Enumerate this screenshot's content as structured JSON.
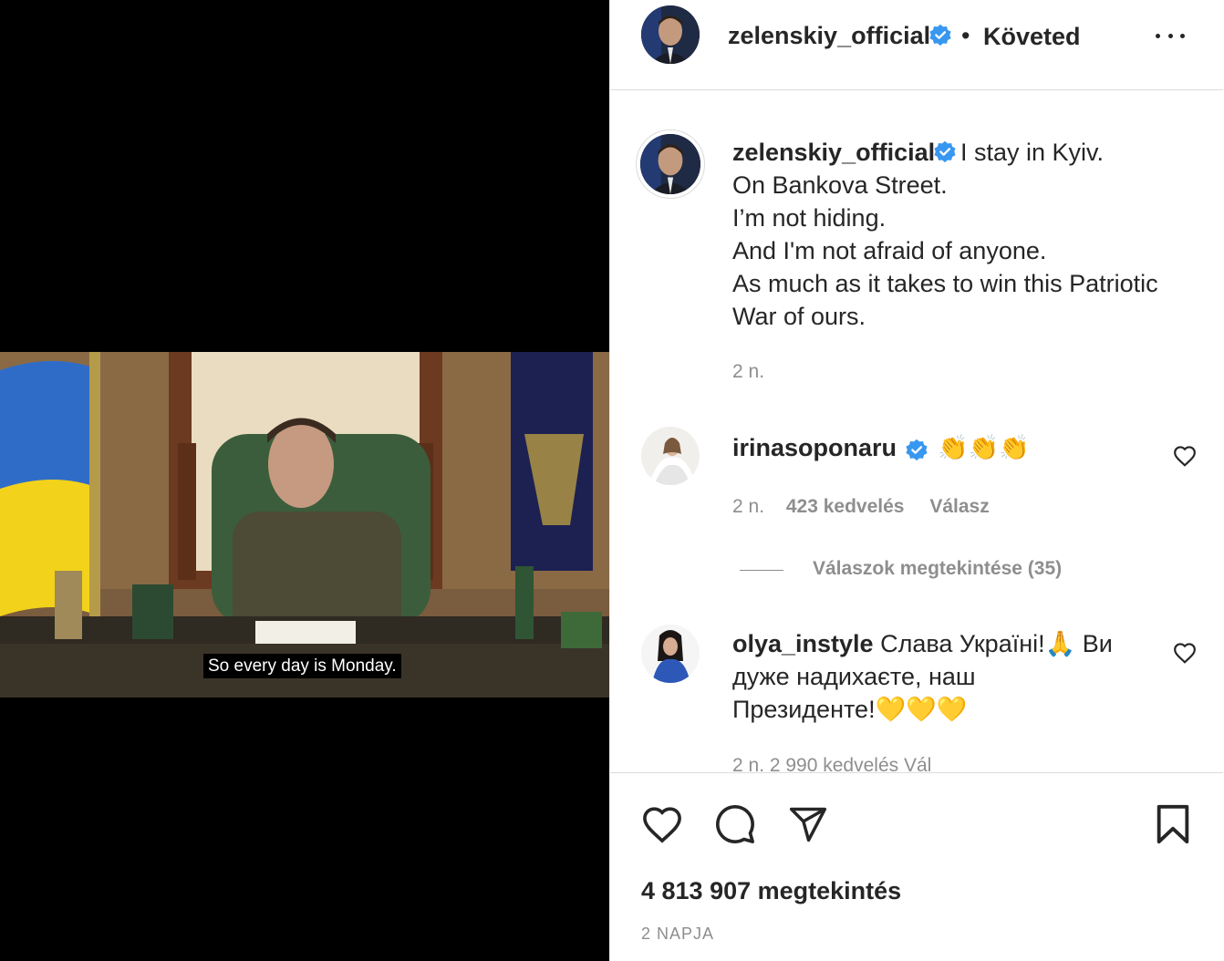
{
  "media": {
    "subtitle": "So every day is Monday."
  },
  "post": {
    "username": "zelenskiy_official",
    "separator": "•",
    "follow_status": "Követed",
    "caption_lines": [
      "I stay in Kyiv.",
      "On Bankova Street.",
      "I’m not hiding.",
      "And I'm not afraid of anyone.",
      "As much as it takes to win this Patriotic",
      "War of ours."
    ],
    "caption_time": "2 n."
  },
  "comments": [
    {
      "username": "irinasoponaru",
      "text": "👏👏👏",
      "time": "2 n.",
      "likes": "423 kedvelés",
      "reply": "Válasz",
      "view_replies": "Válaszok megtekintése (35)"
    },
    {
      "username": "olya_instyle",
      "text_line1": "Слава Україні!🙏 Ви",
      "text_line2": "дуже надихаєте, наш",
      "text_line3": "Президенте!💛💛💛",
      "meta_partial": "2 n.    2 990 kedvelés   Vál"
    }
  ],
  "footer": {
    "views": "4 813 907 megtekintés",
    "posted": "2 NAPJA"
  },
  "colors": {
    "verified_blue": "#3897f0",
    "muted_text": "#8e8e8e",
    "border": "#dbdbdb"
  },
  "icons": {
    "like": "heart-icon",
    "comment": "comment-bubble-icon",
    "share": "paper-plane-icon",
    "save": "bookmark-icon",
    "more": "more-options-icon"
  }
}
